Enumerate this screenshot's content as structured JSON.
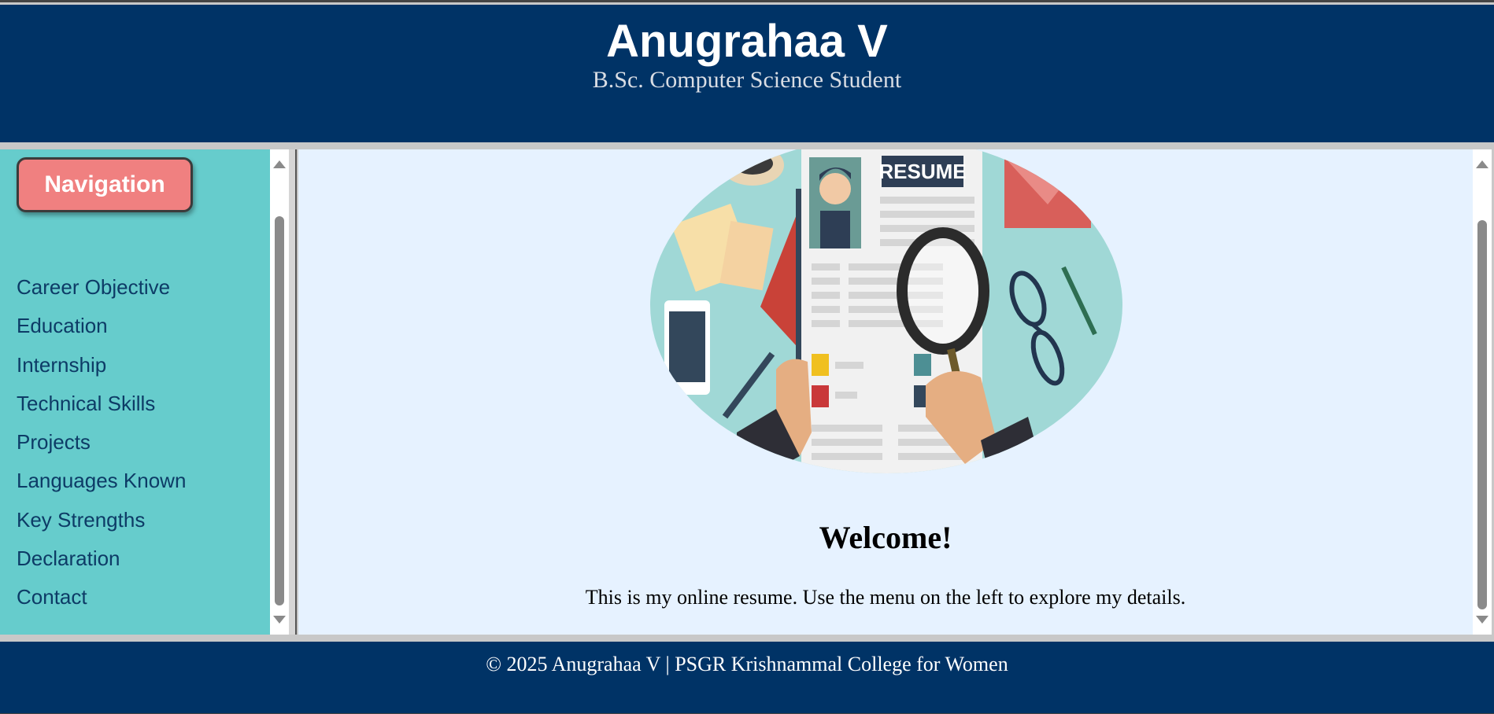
{
  "header": {
    "name": "Anugrahaa V",
    "subtitle": "B.Sc. Computer Science Student"
  },
  "nav": {
    "button_label": "Navigation",
    "items": [
      {
        "label": "Career Objective"
      },
      {
        "label": "Education"
      },
      {
        "label": "Internship"
      },
      {
        "label": "Technical Skills"
      },
      {
        "label": "Projects"
      },
      {
        "label": "Languages Known"
      },
      {
        "label": "Key Strengths"
      },
      {
        "label": "Declaration"
      },
      {
        "label": "Contact"
      }
    ]
  },
  "main": {
    "hero_image_text": "RESUME",
    "welcome": "Welcome!",
    "intro": "This is my online resume. Use the menu on the left to explore my details."
  },
  "footer": {
    "copyright": "© 2025 Anugrahaa V | PSGR Krishnammal College for Women"
  },
  "colors": {
    "header_bg": "#003366",
    "nav_bg": "#66cccc",
    "nav_button": "#f08080",
    "main_bg": "#e6f2ff",
    "link": "#0d3b66"
  }
}
